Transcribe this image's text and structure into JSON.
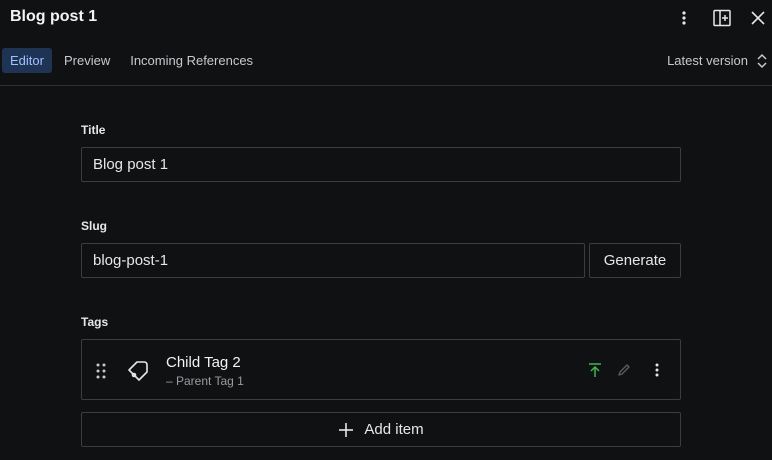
{
  "document": {
    "title": "Blog post 1"
  },
  "tabs": [
    {
      "label": "Editor",
      "active": true
    },
    {
      "label": "Preview",
      "active": false
    },
    {
      "label": "Incoming References",
      "active": false
    }
  ],
  "version_selector": {
    "label": "Latest version"
  },
  "fields": {
    "title": {
      "label": "Title",
      "value": "Blog post 1"
    },
    "slug": {
      "label": "Slug",
      "value": "blog-post-1",
      "generate_label": "Generate"
    },
    "tags": {
      "label": "Tags",
      "items": [
        {
          "name": "Child Tag 2",
          "parent": "– Parent Tag 1"
        }
      ],
      "add_label": "Add item"
    }
  },
  "icons": {
    "menu": "vertical-dots-icon",
    "split": "split-pane-icon",
    "close": "close-icon",
    "drag": "drag-handle-icon",
    "tag": "tag-icon",
    "publish": "upload-icon",
    "edit": "pencil-icon",
    "add": "plus-icon"
  },
  "colors": {
    "background": "#101112",
    "active_tab_bg": "#1f3455",
    "active_tab_text": "#9fc1ff",
    "publish_icon": "#3fb950",
    "border": "#3a3d43"
  }
}
